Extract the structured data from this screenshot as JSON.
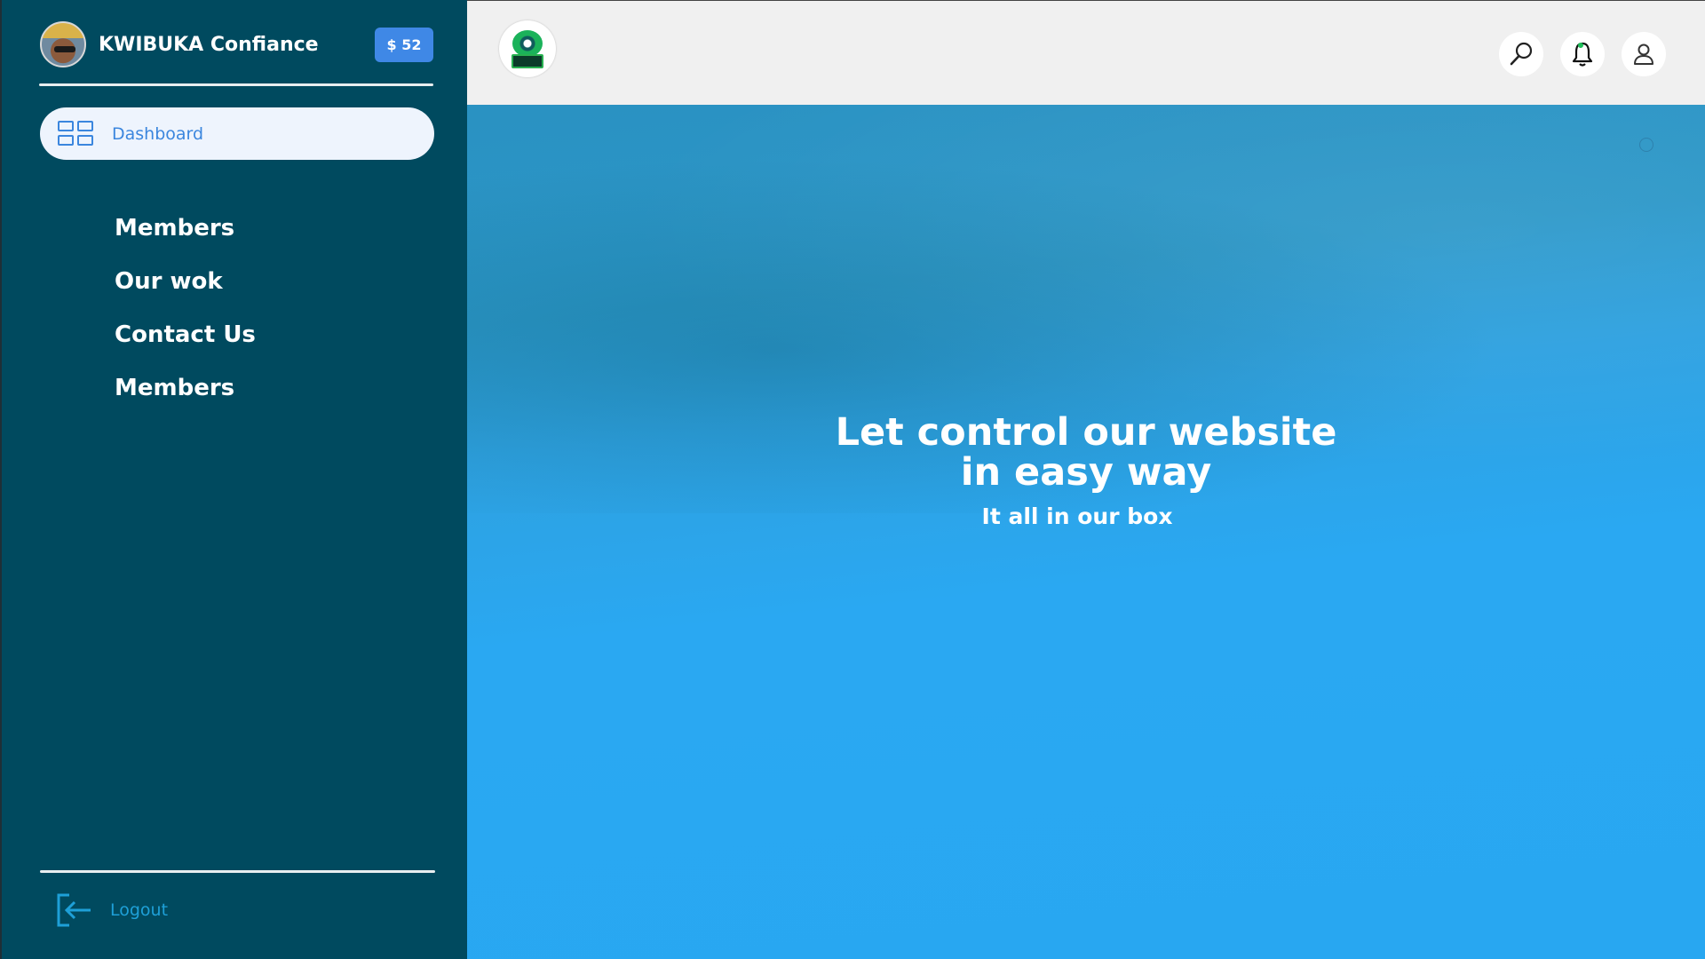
{
  "sidebar": {
    "profile_name": "KWIBUKA Confiance",
    "balance": "$ 52",
    "dashboard_label": "Dashboard",
    "nav": [
      {
        "label": "Members"
      },
      {
        "label": "Our wok"
      },
      {
        "label": "Contact Us"
      },
      {
        "label": "Members"
      }
    ],
    "logout_label": "Logout"
  },
  "topbar": {
    "icons": [
      "search-icon",
      "bell-icon",
      "user-icon"
    ]
  },
  "hero": {
    "title_line1": "Let control our website",
    "title_line2": "in easy way",
    "subtitle": "It all in our box"
  },
  "colors": {
    "sidebar_bg": "#004a5f",
    "accent": "#3b86de",
    "badge": "#3f88e6",
    "main_bg": "#2aa7ef",
    "notification_dot": "#1fbf5a"
  }
}
